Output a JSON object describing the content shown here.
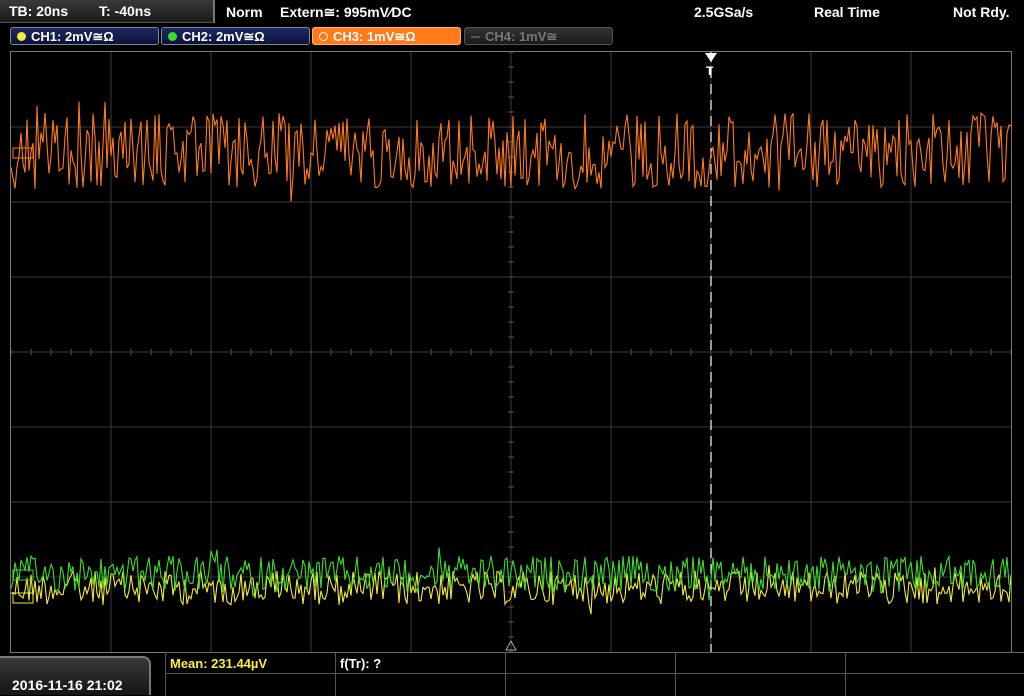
{
  "topbar": {
    "timebase": "TB: 20ns",
    "trigger_time": "T: -40ns",
    "mode": "Norm",
    "trigger_source": "Extern≅: 995mV∕DC",
    "sample_rate": "2.5GSa/s",
    "acq_mode": "Real Time",
    "status": "Not Rdy."
  },
  "channels": [
    {
      "label": "CH1: 2mV≅Ω",
      "color": "#f2ea3b"
    },
    {
      "label": "CH2: 2mV≅Ω",
      "color": "#3ddc2e"
    },
    {
      "label": "CH3: 1mV≅Ω",
      "color": "#ff7a1a"
    },
    {
      "label": "CH4: 1mV≅",
      "color": "#777777"
    }
  ],
  "trigger": {
    "marker": "T"
  },
  "bottom": {
    "datetime": "2016-11-16 21:02",
    "measurement_1": "Mean: 231.44µV",
    "measurement_2": "f(Tr): ?"
  },
  "colors": {
    "ch1": "#f2ea3b",
    "ch2": "#3ddc2e",
    "ch3": "#ff7a1a",
    "grid": "#3a3a3a",
    "meas_label": "#ffee33"
  },
  "icons": {
    "trigger_pos": "down-triangle-icon",
    "ref_pos": "up-triangle-icon"
  }
}
